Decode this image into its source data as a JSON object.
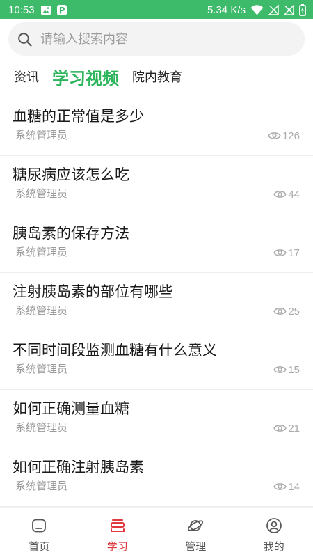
{
  "status_bar": {
    "time": "10:53",
    "network_speed": "5.34 K/s"
  },
  "search": {
    "placeholder": "请输入搜索内容",
    "icon": "search-icon"
  },
  "tabs": [
    {
      "label": "资讯",
      "active": false
    },
    {
      "label": "学习视频",
      "active": true
    },
    {
      "label": "院内教育",
      "active": false
    }
  ],
  "articles": [
    {
      "title": "血糖的正常值是多少",
      "author": "系统管理员",
      "views": 126
    },
    {
      "title": "糖尿病应该怎么吃",
      "author": "系统管理员",
      "views": 44
    },
    {
      "title": "胰岛素的保存方法",
      "author": "系统管理员",
      "views": 17
    },
    {
      "title": "注射胰岛素的部位有哪些",
      "author": "系统管理员",
      "views": 25
    },
    {
      "title": "不同时间段监测血糖有什么意义",
      "author": "系统管理员",
      "views": 15
    },
    {
      "title": "如何正确测量血糖",
      "author": "系统管理员",
      "views": 21
    },
    {
      "title": "如何正确注射胰岛素",
      "author": "系统管理员",
      "views": 14
    }
  ],
  "view_icon": "eye-icon",
  "bottom_nav": [
    {
      "label": "首页",
      "icon": "home-icon",
      "active": false
    },
    {
      "label": "学习",
      "icon": "study-icon",
      "active": true
    },
    {
      "label": "管理",
      "icon": "planet-icon",
      "active": false
    },
    {
      "label": "我的",
      "icon": "user-icon",
      "active": false
    }
  ],
  "colors": {
    "status_bar": "#3dba6a",
    "accent_green": "#2db55d",
    "nav_active": "#e0383e"
  }
}
